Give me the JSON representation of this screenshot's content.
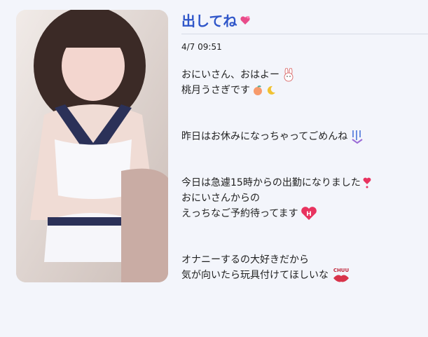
{
  "post": {
    "title": "出してね",
    "title_icon": "pink-hearts-icon",
    "date": "4/7 09:51"
  },
  "message": {
    "line1": "おにいさん、おはよー",
    "line2": "桃月うさぎです",
    "line3": "昨日はお休みになっちゃってごめんね",
    "line4": "今日は急遽15時からの出勤になりました",
    "line5": "おにいさんからの",
    "line6": "えっちなご予約待ってます",
    "line7": "オナニーするの大好きだから",
    "line8": "気が向いたら玩具付けてほしいな",
    "chu_text": "CHUU",
    "icons": [
      "bunny-icon",
      "peach-icon",
      "moon-icon",
      "sweat-drops-icon",
      "heart-exclaim-icon",
      "heart-h-icon",
      "lips-icon"
    ]
  },
  "colors": {
    "accent": "#2f56c9",
    "background": "#f3f5fb"
  }
}
